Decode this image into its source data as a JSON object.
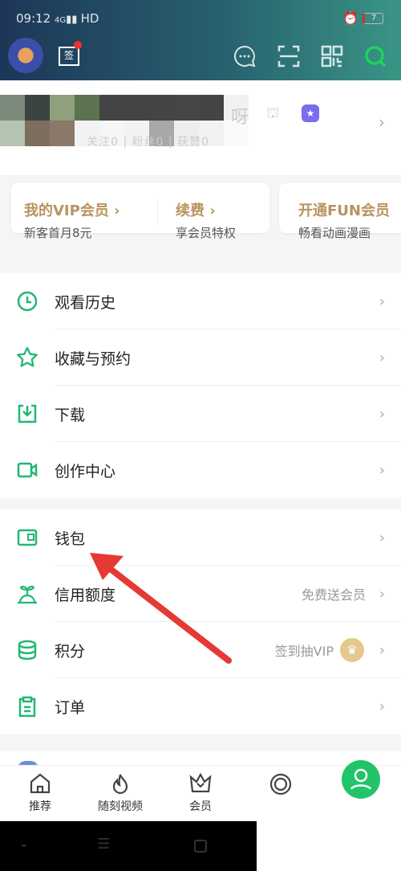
{
  "status_bar": {
    "time": "09:12",
    "network": "4G",
    "hd": "HD",
    "battery": "7"
  },
  "header": {
    "sign_label": "签",
    "icons": [
      "avatar",
      "sign-in-calendar-icon",
      "message-icon",
      "scan-icon",
      "qr-code-icon",
      "search-icon"
    ]
  },
  "profile": {
    "name_visible": "呀",
    "stats": "关注0 | 粉丝0 | 获赞0"
  },
  "vip_cards": [
    {
      "title": "我的VIP会员 ›",
      "subtitle": "新客首月8元"
    },
    {
      "title": "续费 ›",
      "subtitle": "享会员特权"
    },
    {
      "title": "开通FUN会员",
      "subtitle": "畅看动画漫画"
    }
  ],
  "menu_group1": [
    {
      "label": "观看历史",
      "icon": "clock-icon"
    },
    {
      "label": "收藏与预约",
      "icon": "star-icon"
    },
    {
      "label": "下载",
      "icon": "download-icon"
    },
    {
      "label": "创作中心",
      "icon": "video-camera-icon"
    }
  ],
  "menu_group2": [
    {
      "label": "钱包",
      "icon": "wallet-icon",
      "sub": ""
    },
    {
      "label": "信用额度",
      "icon": "sprout-icon",
      "sub": "免费送会员"
    },
    {
      "label": "积分",
      "icon": "coins-icon",
      "sub": "签到抽VIP"
    },
    {
      "label": "订单",
      "icon": "clipboard-icon",
      "sub": ""
    }
  ],
  "tabbar": [
    {
      "label": "推荐"
    },
    {
      "label": "随刻视频"
    },
    {
      "label": "会员"
    },
    {
      "label": ""
    },
    {
      "label": ""
    }
  ],
  "colors": {
    "accent": "#21b872",
    "vip_gold": "#b9935e",
    "annotation_arrow": "#e53935"
  }
}
